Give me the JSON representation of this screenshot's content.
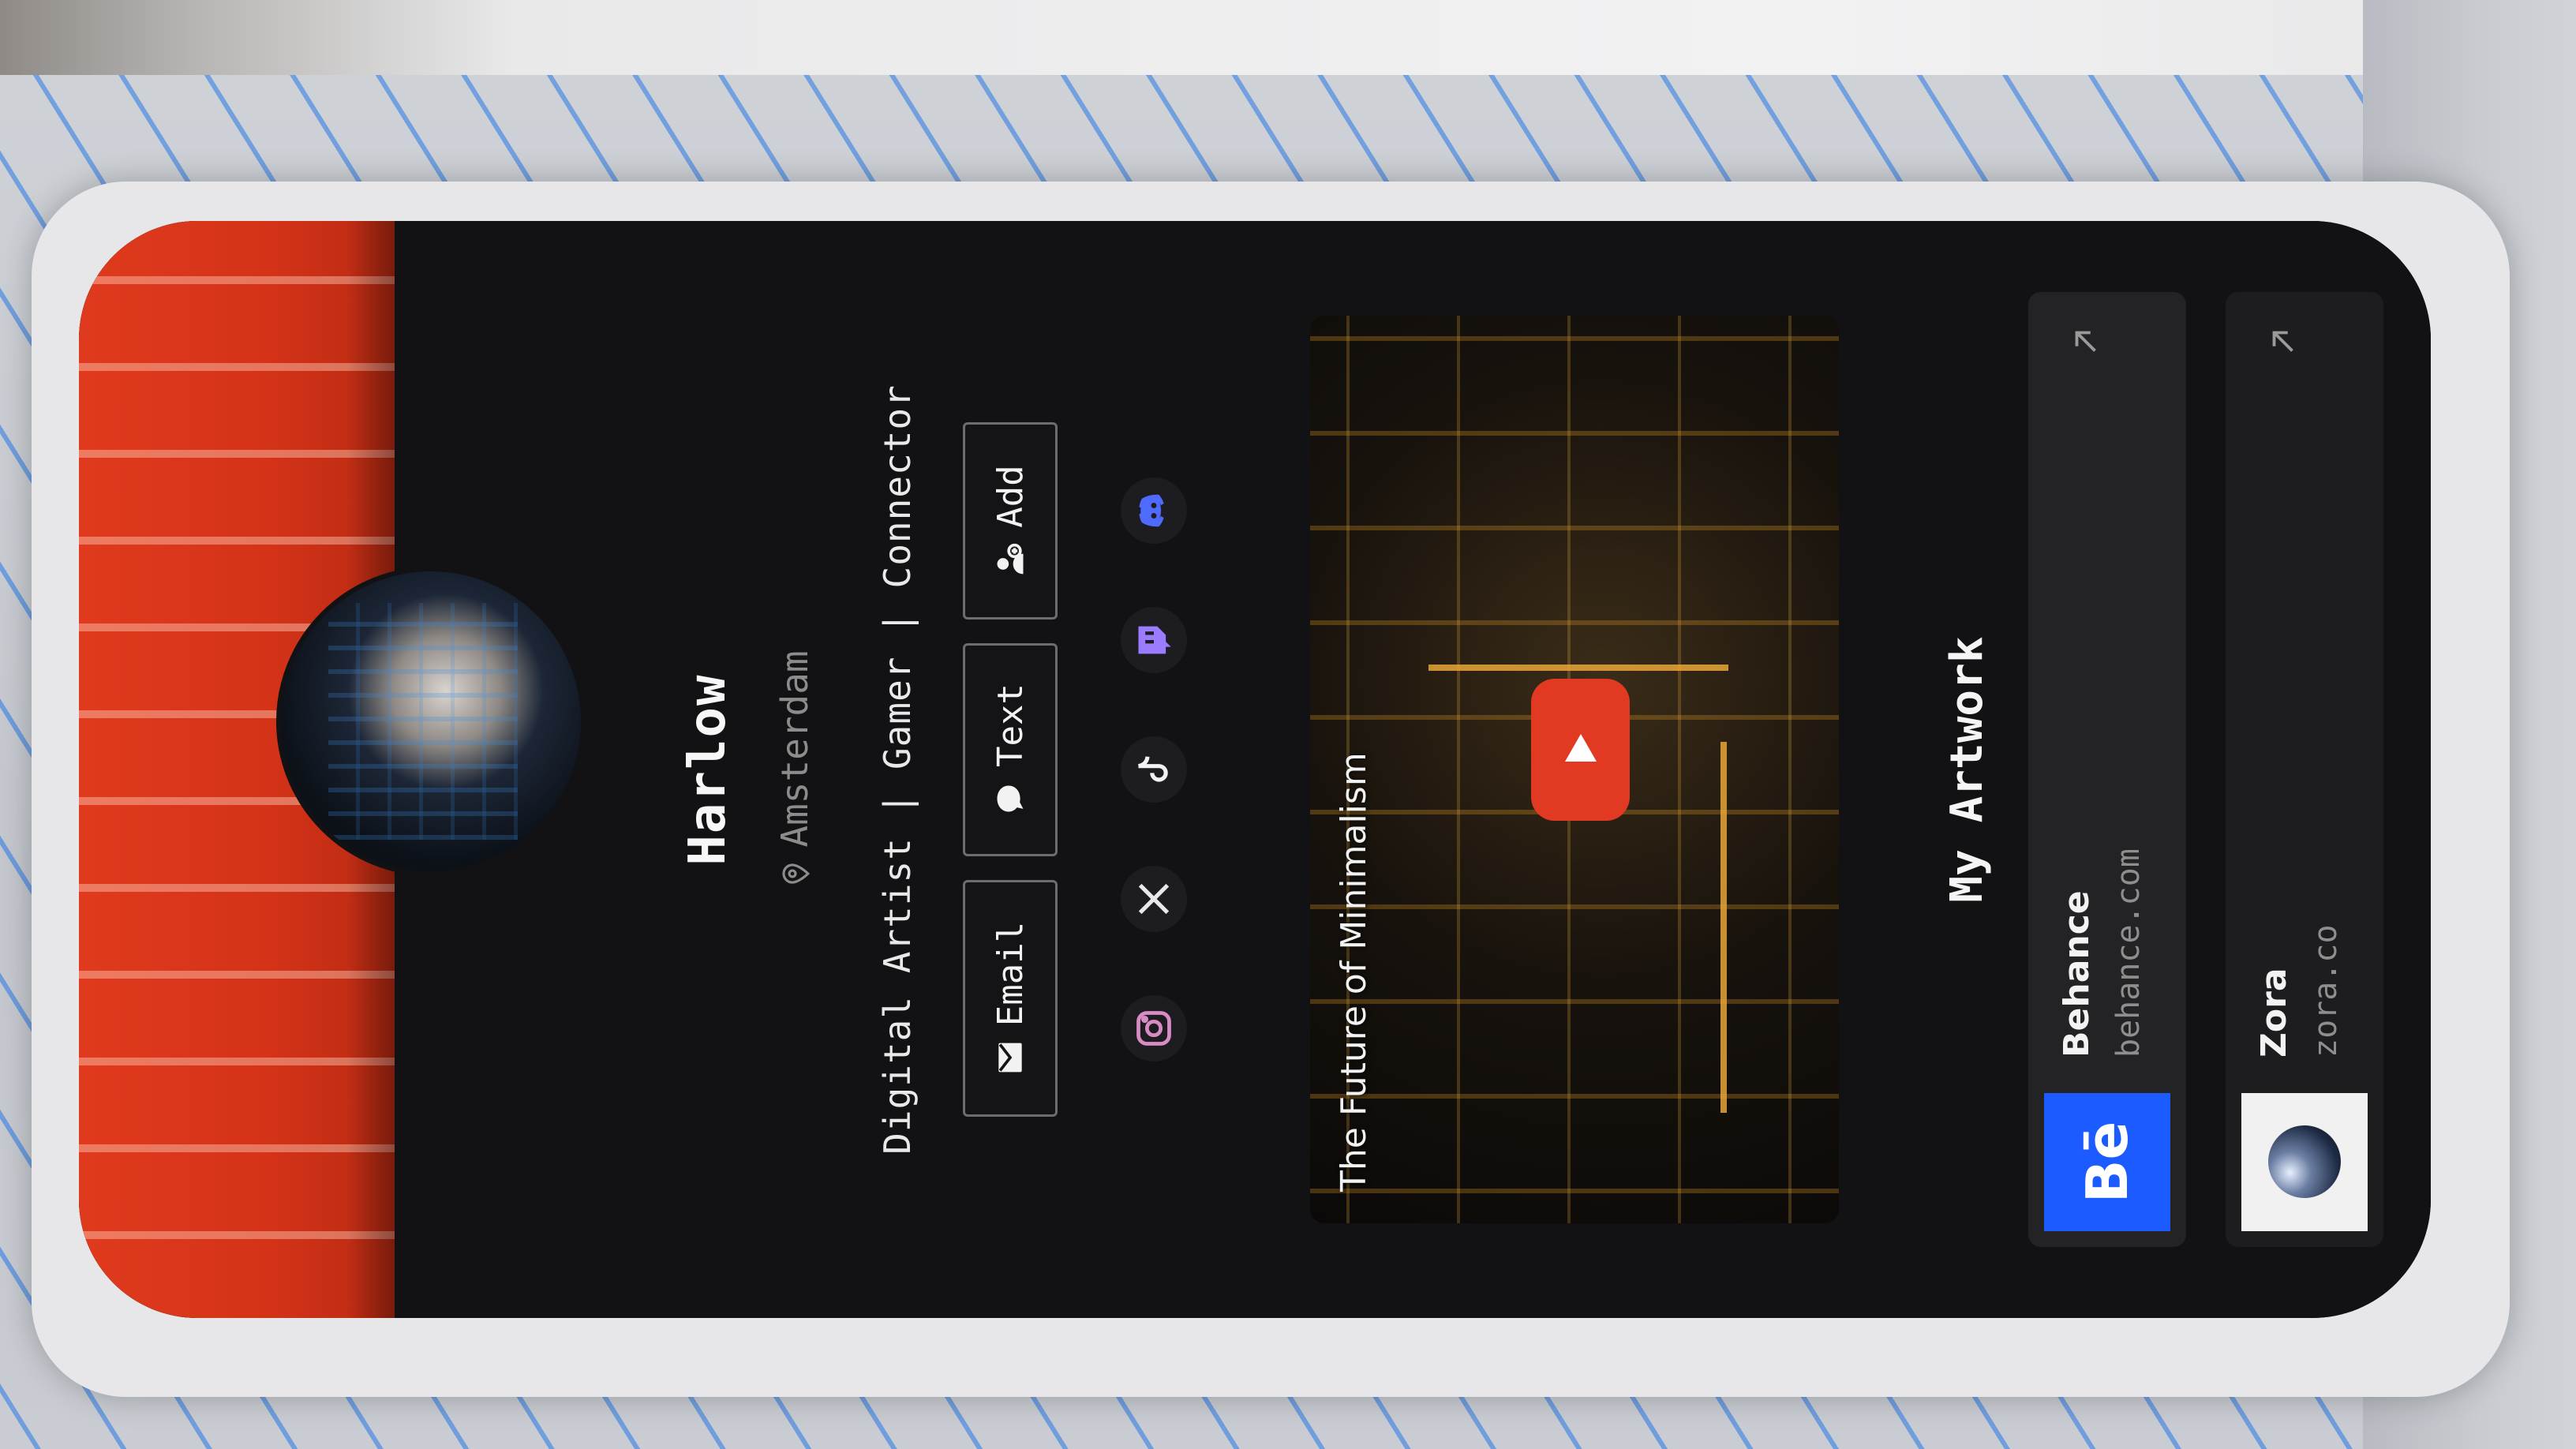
{
  "profile": {
    "name": "Harlow",
    "location": "Amsterdam",
    "bio": "Digital Artist | Gamer | Connector"
  },
  "contact": {
    "email_label": "Email",
    "text_label": "Text",
    "add_label": "Add"
  },
  "social": [
    "instagram-icon",
    "x-icon",
    "tiktok-icon",
    "twitch-icon",
    "discord-icon"
  ],
  "video": {
    "title": "The Future of Minimalism"
  },
  "section": {
    "title": "My Artwork"
  },
  "links": [
    {
      "name": "Behance",
      "url": "behance.com",
      "logo_text": "Bē"
    },
    {
      "name": "Zora",
      "url": "zora.co"
    }
  ],
  "colors": {
    "cover": "#d43318",
    "background": "#121214",
    "youtube_red": "#e23a22",
    "behance_blue": "#1b5bff",
    "discord": "#5865f2",
    "twitch": "#9146ff"
  }
}
